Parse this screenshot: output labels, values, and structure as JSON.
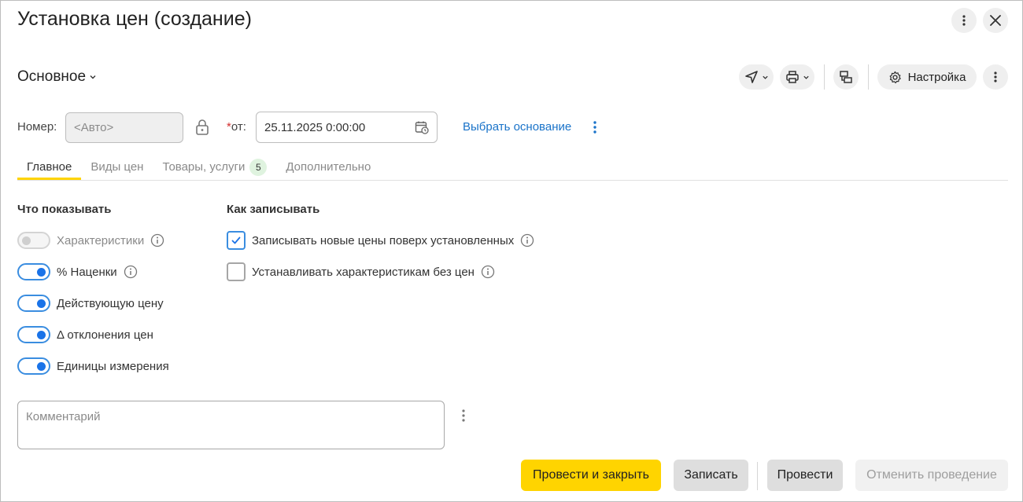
{
  "window": {
    "title": "Установка цен (создание)"
  },
  "toolbar": {
    "section_label": "Основное",
    "settings_label": "Настройка"
  },
  "header_fields": {
    "number_label": "Номер:",
    "number_placeholder": "<Авто>",
    "required_mark": "*",
    "date_label": "от:",
    "date_value": "25.11.2025  0:00:00",
    "basis_link": "Выбрать основание"
  },
  "tabs": [
    {
      "label": "Главное",
      "active": true
    },
    {
      "label": "Виды цен",
      "active": false
    },
    {
      "label": "Товары, услуги",
      "badge": "5",
      "active": false
    },
    {
      "label": "Дополнительно",
      "active": false
    }
  ],
  "show_section": {
    "title": "Что показывать",
    "items": [
      {
        "label": "Характеристики",
        "enabled": false,
        "info": true
      },
      {
        "label": "% Наценки",
        "enabled": true,
        "info": true
      },
      {
        "label": "Действующую цену",
        "enabled": true,
        "info": false
      },
      {
        "label": "Δ отклонения цен",
        "enabled": true,
        "info": false
      },
      {
        "label": "Единицы измерения",
        "enabled": true,
        "info": false
      }
    ]
  },
  "write_section": {
    "title": "Как записывать",
    "items": [
      {
        "label": "Записывать новые цены поверх установленных",
        "checked": true
      },
      {
        "label": "Устанавливать характеристикам без цен",
        "checked": false
      }
    ]
  },
  "comment": {
    "placeholder": "Комментарий"
  },
  "actions": {
    "post_and_close": "Провести и закрыть",
    "save": "Записать",
    "post": "Провести",
    "cancel_posting": "Отменить проведение"
  },
  "colors": {
    "accent_yellow": "#ffd400",
    "link_blue": "#1a73c9",
    "toggle_blue": "#1a73e8"
  }
}
